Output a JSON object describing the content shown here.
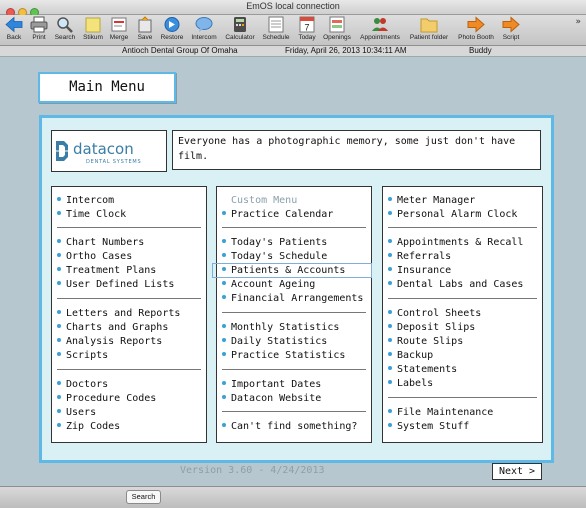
{
  "window": {
    "title": "EmOS local connection"
  },
  "toolbar": {
    "items": [
      {
        "label": "Back",
        "icon": "back-arrow-icon"
      },
      {
        "label": "Print",
        "icon": "printer-icon"
      },
      {
        "label": "Search",
        "icon": "magnifier-icon"
      },
      {
        "label": "Stikum",
        "icon": "sticky-note-icon"
      },
      {
        "label": "Merge",
        "icon": "merge-icon"
      },
      {
        "label": "Save",
        "icon": "save-icon"
      },
      {
        "label": "Restore",
        "icon": "restore-icon"
      },
      {
        "label": "Intercom",
        "icon": "speech-bubble-icon"
      },
      {
        "label": "Calculator",
        "icon": "calculator-icon"
      },
      {
        "label": "Schedule",
        "icon": "schedule-icon"
      },
      {
        "label": "Today",
        "icon": "calendar-today-icon",
        "day": "7"
      },
      {
        "label": "Openings",
        "icon": "openings-icon"
      },
      {
        "label": "Appointments",
        "icon": "appointments-icon"
      },
      {
        "label": "Patient folder",
        "icon": "folder-icon"
      },
      {
        "label": "Photo Booth",
        "icon": "photo-booth-icon"
      },
      {
        "label": "Script",
        "icon": "script-icon"
      }
    ],
    "more": "»"
  },
  "infobar": {
    "practice": "Antioch Dental Group Of Omaha",
    "datetime": "Friday, April 26, 2013   10:34:11 AM",
    "user": "Buddy"
  },
  "main_menu": {
    "title": "Main Menu",
    "logo": {
      "name": "datacon",
      "sub": "DENTAL SYSTEMS"
    },
    "quote": "Everyone has a photographic memory, some just don't have film.",
    "col1": {
      "g1": [
        "Intercom",
        "Time Clock"
      ],
      "g2": [
        "Chart Numbers",
        "Ortho Cases",
        "Treatment Plans",
        "User Defined Lists"
      ],
      "g3": [
        "Letters and Reports",
        "Charts and Graphs",
        "Analysis Reports",
        "Scripts"
      ],
      "g4": [
        "Doctors",
        "Procedure Codes",
        "Users",
        "Zip Codes"
      ]
    },
    "col2": {
      "header": "Custom Menu",
      "g1": [
        "Practice Calendar"
      ],
      "g2": [
        "Today's Patients",
        "Today's Schedule",
        "Patients & Accounts",
        "Account Ageing",
        "Financial Arrangements"
      ],
      "g3": [
        "Monthly Statistics",
        "Daily Statistics",
        "Practice Statistics"
      ],
      "g4": [
        "Important Dates",
        "Datacon Website"
      ],
      "g5": [
        "Can't find something?"
      ]
    },
    "col3": {
      "g1": [
        "Meter Manager",
        "Personal Alarm Clock"
      ],
      "g2": [
        "Appointments & Recall",
        "Referrals",
        "Insurance",
        "Dental Labs and Cases"
      ],
      "g3": [
        "Control Sheets",
        "Deposit Slips",
        "Route Slips",
        "Backup",
        "Statements",
        "Labels"
      ],
      "g4": [
        "File Maintenance",
        "System Stuff"
      ]
    },
    "version": "Version 3.60 - 4/24/2013",
    "next_label": "Next >"
  },
  "bottom": {
    "search_label": "Search"
  },
  "colors": {
    "accent": "#5fb9e6",
    "panel_bg": "#d9f1f5",
    "content_bg": "#b7c7cf",
    "bullet": "#3aa0d6"
  }
}
